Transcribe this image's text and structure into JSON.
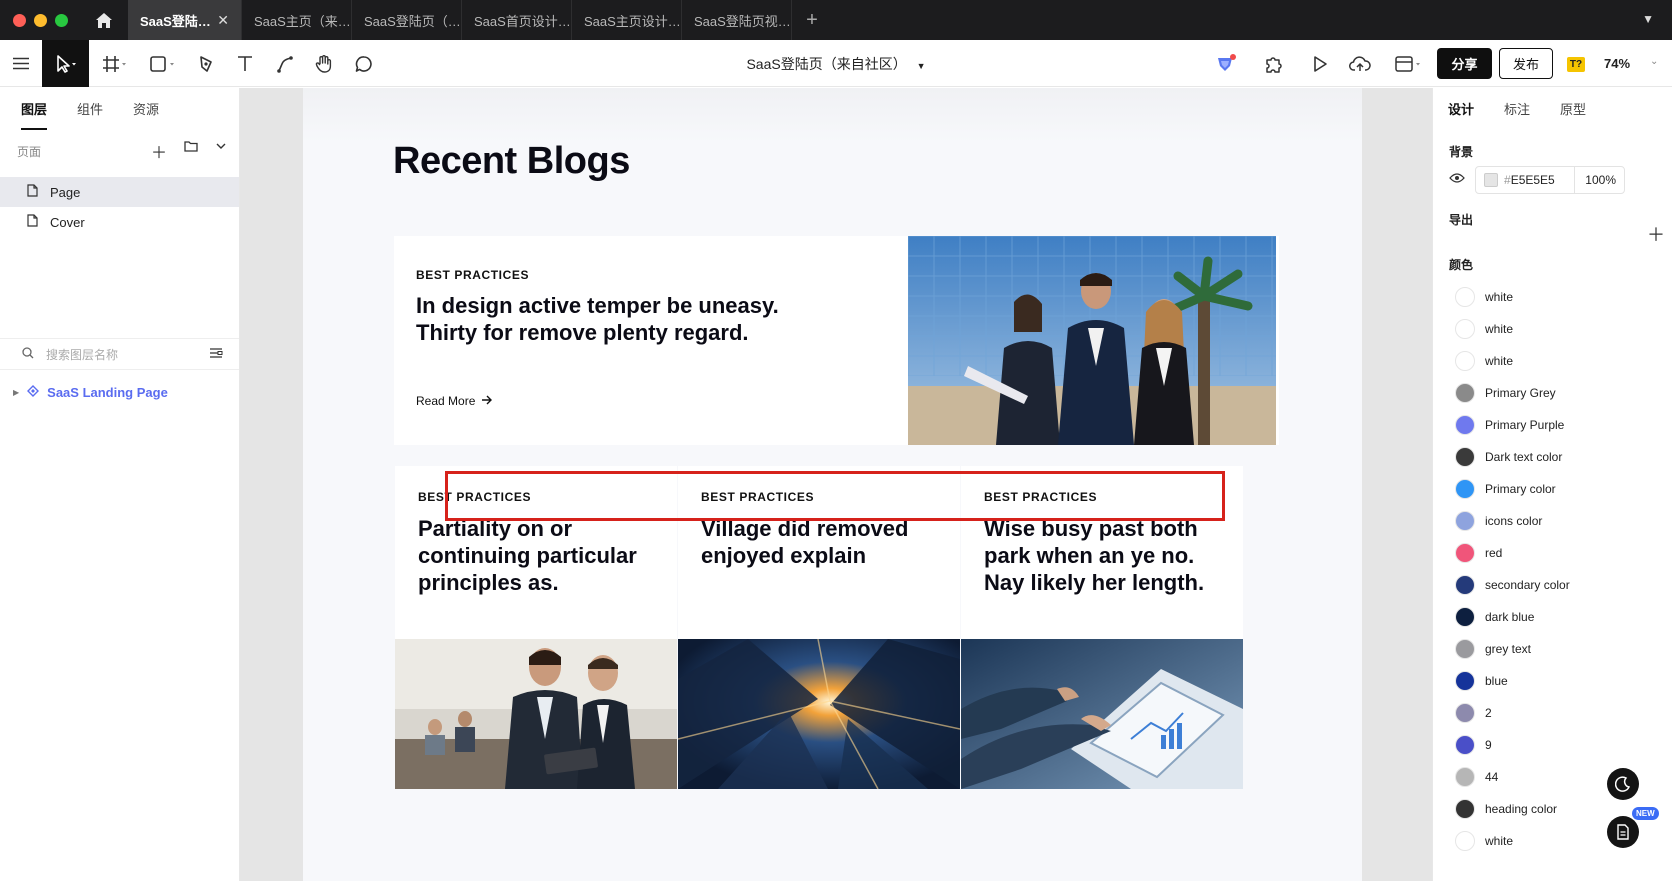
{
  "tabs": {
    "items": [
      {
        "label": "SaaS登陆…"
      },
      {
        "label": "SaaS主页（来…"
      },
      {
        "label": "SaaS登陆页（…"
      },
      {
        "label": "SaaS首页设计…"
      },
      {
        "label": "SaaS主页设计…"
      },
      {
        "label": "SaaS登陆页视…"
      }
    ],
    "close": "✕",
    "add": "+"
  },
  "toolbar": {
    "doc_title": "SaaS登陆页（来自社区）",
    "share": "分享",
    "publish": "发布",
    "translate_badge": "T?",
    "zoom": "74%"
  },
  "left_panel": {
    "tabs": [
      "图层",
      "组件",
      "资源"
    ],
    "pages_label": "页面",
    "pages": [
      "Page",
      "Cover"
    ],
    "search_placeholder": "搜索图层名称",
    "layer": "SaaS Landing Page"
  },
  "canvas": {
    "heading": "Recent Blogs",
    "featured": {
      "category": "BEST PRACTICES",
      "title": "In design active temper be uneasy. Thirty for remove plenty regard.",
      "read_more": "Read More"
    },
    "cards": [
      {
        "category": "BEST PRACTICES",
        "title": "Partiality on or continuing particular principles as."
      },
      {
        "category": "BEST PRACTICES",
        "title": "Village did removed enjoyed explain"
      },
      {
        "category": "BEST PRACTICES",
        "title": "Wise busy past both park when an ye no. Nay likely her length."
      }
    ]
  },
  "right_panel": {
    "tabs": [
      "设计",
      "标注",
      "原型"
    ],
    "background_label": "背景",
    "bg_hex": "E5E5E5",
    "bg_hash": "#",
    "bg_opacity": "100%",
    "export_label": "导出",
    "colors_label": "颜色",
    "colors": [
      {
        "name": "white",
        "hex": "#ffffff"
      },
      {
        "name": "white",
        "hex": "#ffffff"
      },
      {
        "name": "white",
        "hex": "#ffffff"
      },
      {
        "name": "Primary Grey",
        "hex": "#8a8a8a"
      },
      {
        "name": "Primary Purple",
        "hex": "#6f79ee"
      },
      {
        "name": "Dark text color",
        "hex": "#3a3a3a"
      },
      {
        "name": "Primary color",
        "hex": "#2f95f5"
      },
      {
        "name": "icons color",
        "hex": "#8ea3de"
      },
      {
        "name": "red",
        "hex": "#f0557a"
      },
      {
        "name": "secondary color",
        "hex": "#243a7a"
      },
      {
        "name": "dark blue",
        "hex": "#0d1f3f"
      },
      {
        "name": "grey text",
        "hex": "#9a9a9e"
      },
      {
        "name": "blue",
        "hex": "#15339a"
      },
      {
        "name": "2",
        "hex": "#8d8aad"
      },
      {
        "name": "9",
        "hex": "#4a4fc8"
      },
      {
        "name": "44",
        "hex": "#b6b6b6"
      },
      {
        "name": "heading color",
        "hex": "#333333"
      },
      {
        "name": "white",
        "hex": "#ffffff"
      }
    ],
    "new_badge": "NEW"
  }
}
